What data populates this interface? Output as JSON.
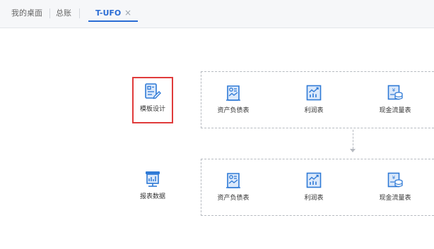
{
  "tabs": [
    {
      "label": "我的桌面"
    },
    {
      "label": "总账"
    },
    {
      "label": "T-UFO"
    }
  ],
  "tab_close_glyph": "×",
  "left_items": [
    {
      "label": "模板设计",
      "icon": "template-design-icon",
      "selected": true
    },
    {
      "label": "报表数据",
      "icon": "report-data-icon",
      "selected": false
    }
  ],
  "top_row": [
    {
      "label": "资产负债表",
      "icon": "balance-sheet-icon"
    },
    {
      "label": "利润表",
      "icon": "income-statement-icon"
    },
    {
      "label": "现金流量表",
      "icon": "cash-flow-icon"
    }
  ],
  "bottom_row": [
    {
      "label": "资产负债表",
      "icon": "balance-sheet-icon"
    },
    {
      "label": "利润表",
      "icon": "income-statement-icon"
    },
    {
      "label": "现金流量表",
      "icon": "cash-flow-icon"
    }
  ],
  "colors": {
    "accent": "#2a6cd4",
    "selection": "#e03b3b",
    "icon_blue": "#2f7ad6",
    "icon_light": "#dbe9fb"
  }
}
